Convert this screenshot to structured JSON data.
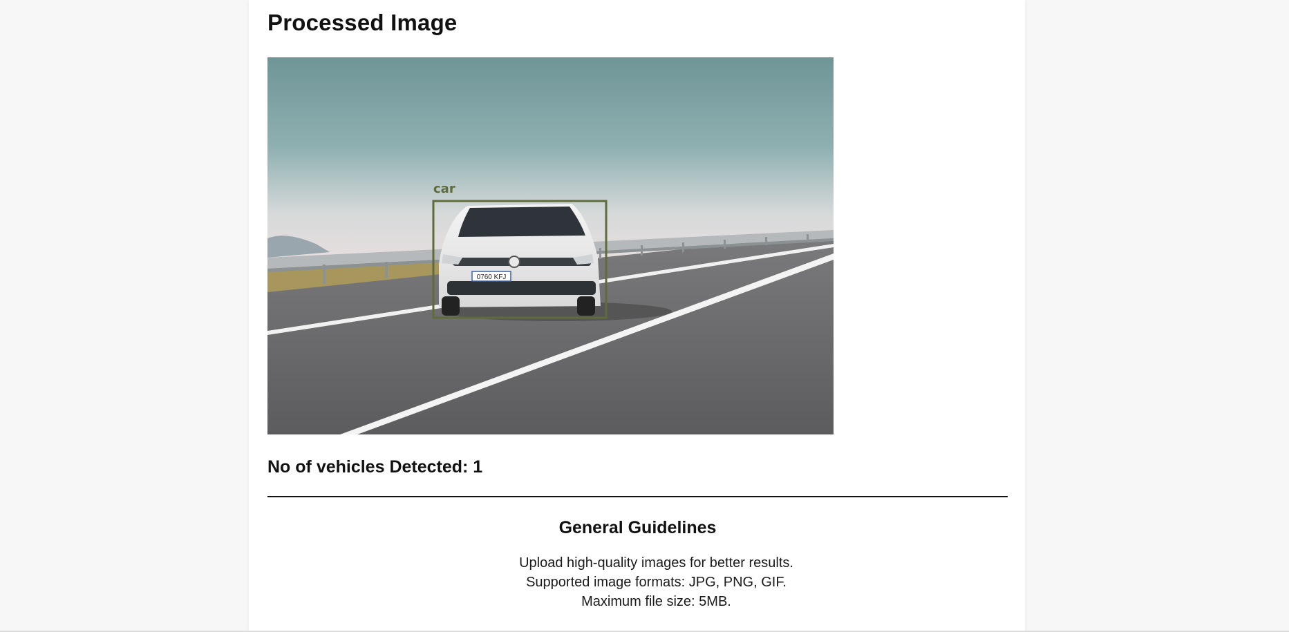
{
  "page": {
    "title": "Processed Image"
  },
  "result": {
    "detection_label": "car",
    "license_plate": "0760 KFJ",
    "count_text": "No of vehicles Detected: 1"
  },
  "guidelines": {
    "heading": "General Guidelines",
    "items": [
      "Upload high-quality images for better results.",
      "Supported image formats: JPG, PNG, GIF.",
      "Maximum file size: 5MB."
    ]
  },
  "colors": {
    "background": "#f7f7f7",
    "panel": "#ffffff",
    "bounding_box": "#5f6b3a",
    "text": "#111111"
  }
}
